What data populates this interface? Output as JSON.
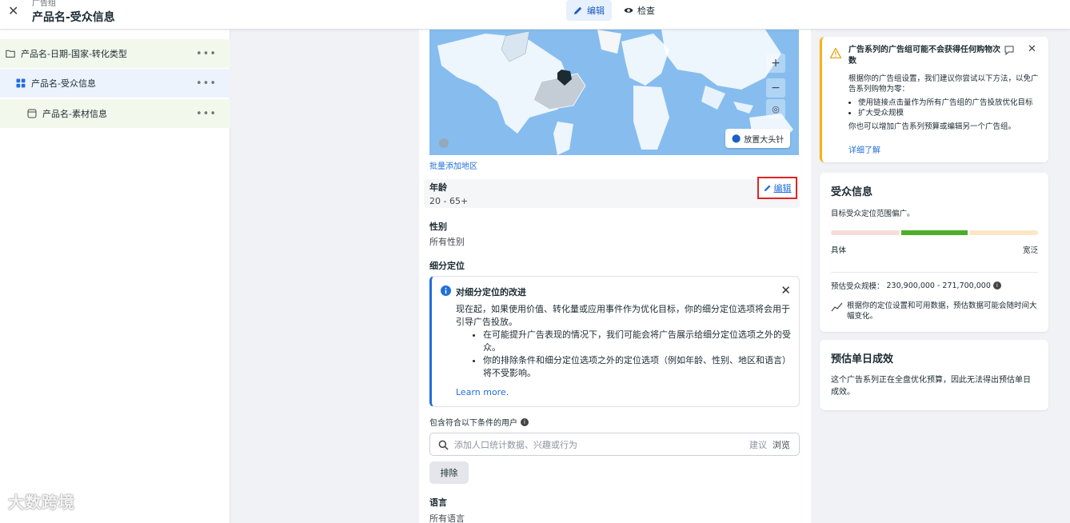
{
  "header": {
    "breadcrumb_small": "广告组",
    "title": "产品名-受众信息",
    "tabs": [
      {
        "label": "编辑",
        "active": true
      },
      {
        "label": "检查",
        "active": false
      }
    ]
  },
  "tree": {
    "items": [
      {
        "label": "产品名-日期-国家-转化类型",
        "level": 0
      },
      {
        "label": "产品名-受众信息",
        "level": 1,
        "selected": true
      },
      {
        "label": "产品名-素材信息",
        "level": 2
      }
    ],
    "more_glyph": "•••"
  },
  "location": {
    "pin_button": "放置大头针",
    "bulk_add_link": "批量添加地区"
  },
  "age": {
    "label": "年龄",
    "value": "20 - 65+",
    "edit_label": "编辑"
  },
  "gender": {
    "label": "性别",
    "value": "所有性别"
  },
  "detailed_targeting": {
    "label": "细分定位",
    "notice": {
      "title": "对细分定位的改进",
      "intro": "现在起，如果使用价值、转化量或应用事件作为优化目标，你的细分定位选项将会用于引导广告投放。",
      "bullets": [
        "在可能提升广告表现的情况下，我们可能会将广告展示给细分定位选项之外的受众。",
        "你的排除条件和细分定位选项之外的定位选项（例如年龄、性别、地区和语言）将不受影响。"
      ],
      "learn_more": "Learn more."
    },
    "include_label": "包含符合以下条件的用户",
    "search_placeholder": "添加人口统计数据、兴趣或行为",
    "suggest": "建议",
    "browse": "浏览",
    "exclude_button": "排除"
  },
  "language": {
    "label": "语言",
    "value": "所有语言"
  },
  "warning_card": {
    "title": "广告系列的广告组可能不会获得任何购物次数",
    "body": "根据你的广告组设置，我们建议你尝试以下方法，以免广告系列购物为零：",
    "bullets": [
      "使用链接点击量作为所有广告组的广告投放优化目标",
      "扩大受众规模"
    ],
    "footer": "你也可以增加广告系列预算或编辑另一个广告组。",
    "learn_more": "详细了解"
  },
  "audience_card": {
    "title": "受众信息",
    "subtitle": "目标受众定位范围偏广。",
    "meter_left": "具体",
    "meter_right": "宽泛",
    "estimate_label": "预估受众规模：",
    "estimate_value": "230,900,000 - 271,700,000",
    "note": "根据你的定位设置和可用数据，预估数据可能会随时间大幅变化。"
  },
  "daily_results_card": {
    "title": "预估单日成效",
    "body": "这个广告系列正在全盘优化预算，因此无法得出预估单日成效。"
  },
  "watermark": "大数跨境",
  "colors": {
    "brand_blue": "#216fdb",
    "warning_yellow": "#f5b317",
    "meter_green": "#4caf29",
    "highlight_red": "#e02424"
  }
}
